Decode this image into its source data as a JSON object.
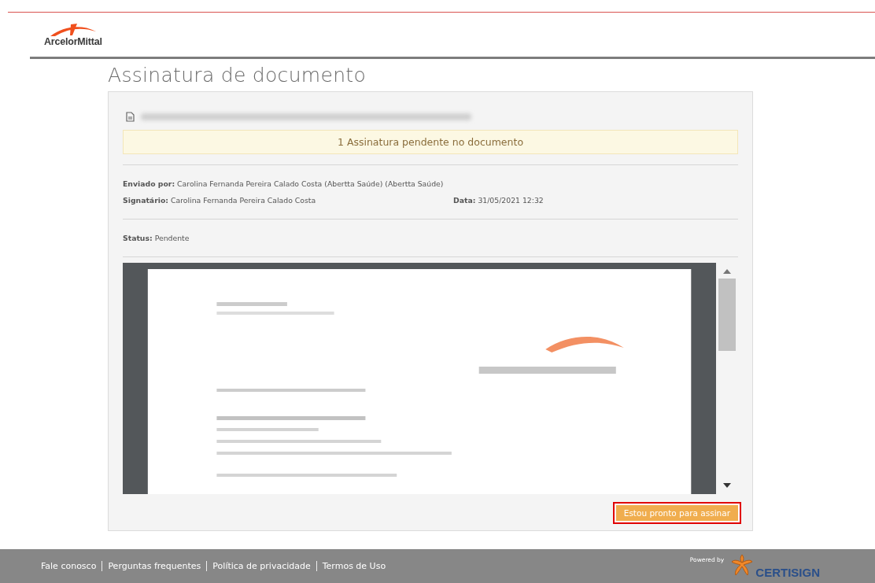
{
  "header": {
    "logo_text": "ArcelorMittal"
  },
  "page": {
    "title": "Assinatura de documento"
  },
  "document": {
    "file_name_redacted": true,
    "alert": "1 Assinatura pendente no documento",
    "sent_by": "**Enviado por:** Carolina Fernanda Pereira Calado Costa (Abertta Saúde) (Abertta Saúde)",
    "signer": "**Signatário:** Carolina Fernanda Pereira Calado Costa",
    "date": "**Data:** 31/05/2021 12:32",
    "status": "**Status:** Pendente",
    "sign_button": {
      "label": "Estou pronto para assinar",
      "highlighted": true
    }
  },
  "footer": {
    "links": [
      "Fale conosco",
      "Perguntas frequentes",
      "Política de privacidade",
      "Termos de Uso"
    ],
    "powered_by": "Powered by",
    "brand": "CERTISIGN"
  }
}
